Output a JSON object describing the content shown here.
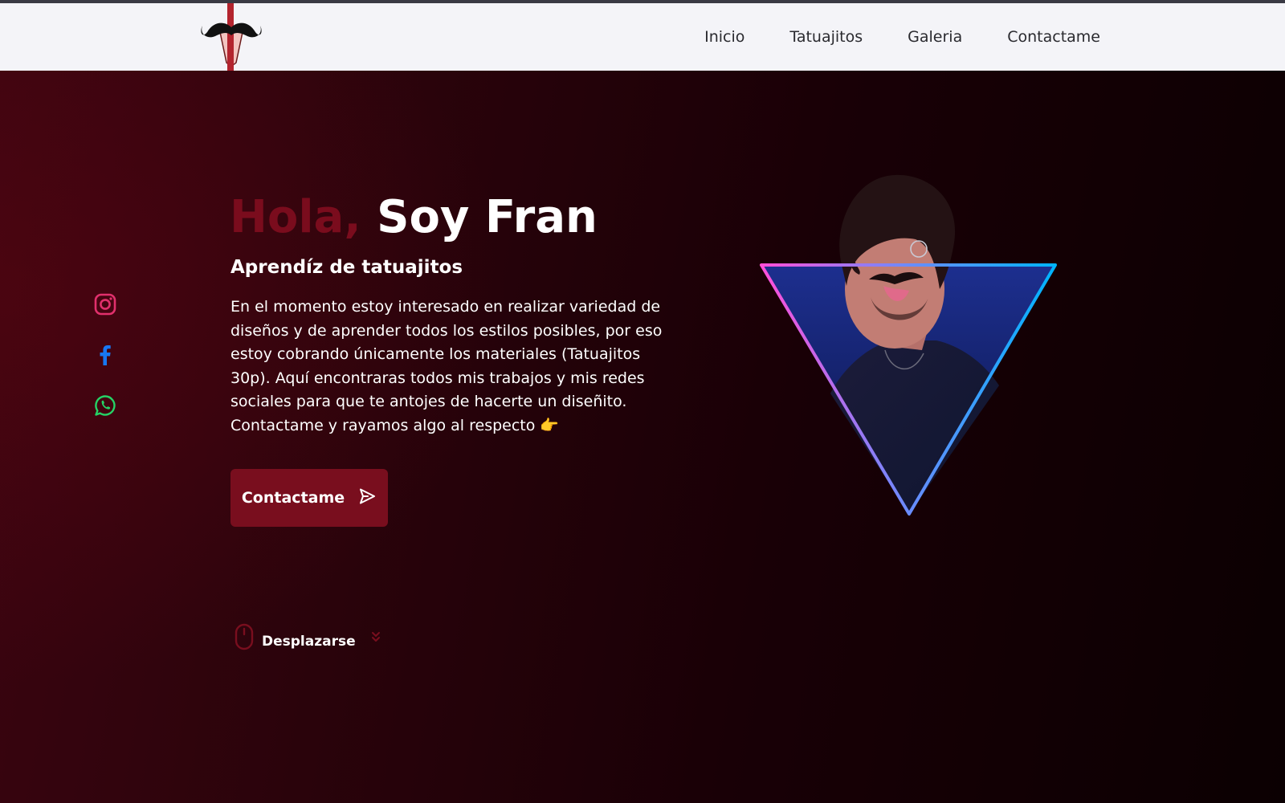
{
  "nav": {
    "links": [
      "Inicio",
      "Tatuajitos",
      "Galeria",
      "Contactame"
    ]
  },
  "social": {
    "icons": [
      "instagram-icon",
      "facebook-icon",
      "whatsapp-icon"
    ]
  },
  "hero": {
    "greeting": "Hola,",
    "name": "Soy Fran",
    "subtitle": "Aprendíz de tatuajitos",
    "description": "En el momento estoy interesado en realizar variedad de diseños y de aprender todos los estilos posibles, por eso estoy cobrando únicamente los materiales (Tatuajitos 30p). Aquí encontraras todos mis trabajos y mis redes sociales para que te antojes de hacerte un diseñito. Contactame y rayamos algo al respecto 👉",
    "cta_label": "Contactame",
    "scroll_label": "Desplazarse"
  },
  "colors": {
    "accent": "#790e1e",
    "instagram": "#e1306c",
    "facebook": "#1877f2",
    "whatsapp": "#25d366",
    "triangle_left": "#ff4fd8",
    "triangle_right": "#00b4ff"
  }
}
